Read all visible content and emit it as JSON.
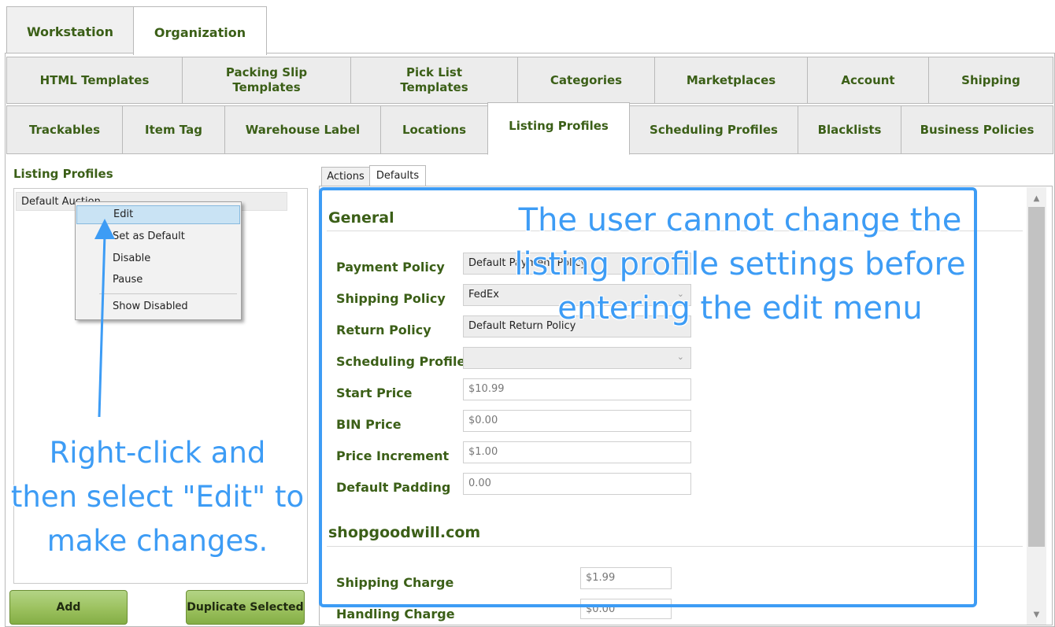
{
  "top_tabs": [
    "Workstation",
    "Organization"
  ],
  "sub_tabs_row1": [
    "HTML Templates",
    "Packing Slip Templates",
    "Pick List Templates",
    "Categories",
    "Marketplaces",
    "Account",
    "Shipping"
  ],
  "sub_tabs_row2": [
    "Trackables",
    "Item Tag",
    "Warehouse Label",
    "Locations",
    "Listing Profiles",
    "Scheduling Profiles",
    "Blacklists",
    "Business Policies"
  ],
  "left": {
    "title": "Listing Profiles",
    "list_item": "Default Auction",
    "add_button": "Add",
    "duplicate_button": "Duplicate Selected"
  },
  "context_menu": {
    "items": [
      "Edit",
      "Set as Default",
      "Disable",
      "Pause",
      "Show Disabled"
    ]
  },
  "right_tabs": [
    "Actions",
    "Defaults"
  ],
  "general": {
    "title": "General",
    "payment_label": "Payment Policy",
    "payment_value": "Default Payment Policy",
    "shipping_label": "Shipping Policy",
    "shipping_value": "FedEx",
    "return_label": "Return Policy",
    "return_value": "Default Return Policy",
    "scheduling_label": "Scheduling Profile",
    "scheduling_value": "",
    "start_price_label": "Start Price",
    "start_price_value": "$10.99",
    "bin_price_label": "BIN Price",
    "bin_price_value": "$0.00",
    "increment_label": "Price Increment",
    "increment_value": "$1.00",
    "padding_label": "Default Padding",
    "padding_value": "0.00"
  },
  "shopgoodwill": {
    "title": "shopgoodwill.com",
    "shipping_charge_label": "Shipping Charge",
    "shipping_charge_value": "$1.99",
    "handling_charge_label": "Handling Charge",
    "handling_charge_value": "$0.00"
  },
  "annotations": {
    "right_line1": "The user cannot change the",
    "right_line2": "listing profile settings before",
    "right_line3": "entering the edit menu",
    "left_line1": "Right-click and",
    "left_line2": "then select \"Edit\" to",
    "left_line3": "make changes."
  },
  "colors": {
    "accent_green": "#3b5f17",
    "callout_blue": "#3d9cf5",
    "button_green": "#9bc15e"
  }
}
